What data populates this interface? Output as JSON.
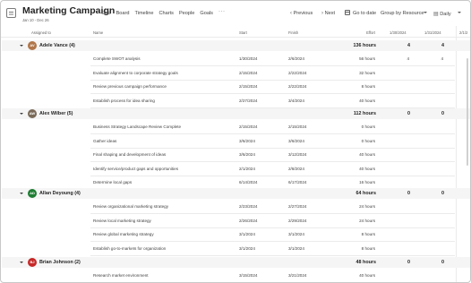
{
  "header": {
    "title": "Marketing Campaign",
    "subtitle": "Jan 10 - Dec 26",
    "views": [
      "Grid",
      "Board",
      "Timeline",
      "Charts",
      "People",
      "Goals"
    ],
    "more": "···",
    "previous": "Previous",
    "next": "Next",
    "go_to_date": "Go to date",
    "group_by": "Group by Resource",
    "timescale": "Daily"
  },
  "columns": {
    "assigned_to": "Assigned to",
    "name": "Name",
    "start": "Start",
    "finish": "Finish",
    "effort": "Effort",
    "date1": "1/30/2024",
    "date2": "1/31/2024",
    "date3": "2/1/2"
  },
  "groups": [
    {
      "name": "Adele Vance",
      "count": "(4)",
      "initials": "AV",
      "avatar_color": "#b0764a",
      "effort": "136 hours",
      "d1": "4",
      "d2": "4",
      "tasks": [
        {
          "name": "Complete SWOT analysis",
          "start": "1/30/2024",
          "finish": "2/6/2024",
          "effort": "56 hours",
          "d1": "4",
          "d2": "4"
        },
        {
          "name": "Evaluate alignment to corporate strategy goals",
          "start": "2/15/2024",
          "finish": "2/22/2024",
          "effort": "32 hours",
          "d1": "",
          "d2": ""
        },
        {
          "name": "Review previous campaign performance",
          "start": "2/15/2024",
          "finish": "2/22/2024",
          "effort": "8 hours",
          "d1": "",
          "d2": ""
        },
        {
          "name": "Establish process for idea sharing",
          "start": "2/27/2024",
          "finish": "3/4/2024",
          "effort": "40 hours",
          "d1": "",
          "d2": ""
        }
      ]
    },
    {
      "name": "Alex Wilber",
      "count": "(5)",
      "initials": "AW",
      "avatar_color": "#7a6a58",
      "effort": "112 hours",
      "d1": "0",
      "d2": "0",
      "tasks": [
        {
          "name": "Business Strategy Landscape Review Complete",
          "start": "2/15/2024",
          "finish": "2/15/2024",
          "effort": "0 hours",
          "d1": "",
          "d2": ""
        },
        {
          "name": "Gather ideas",
          "start": "3/6/2024",
          "finish": "3/6/2024",
          "effort": "0 hours",
          "d1": "",
          "d2": ""
        },
        {
          "name": "Final shaping and development of ideas",
          "start": "3/6/2024",
          "finish": "3/12/2024",
          "effort": "40 hours",
          "d1": "",
          "d2": ""
        },
        {
          "name": "Identify service/product gaps and opportunities",
          "start": "2/1/2024",
          "finish": "2/8/2024",
          "effort": "40 hours",
          "d1": "",
          "d2": ""
        },
        {
          "name": "Determine local gaps",
          "start": "6/14/2024",
          "finish": "6/17/2024",
          "effort": "16 hours",
          "d1": "",
          "d2": ""
        }
      ]
    },
    {
      "name": "Allan Deyoung",
      "count": "(4)",
      "initials": "AD",
      "avatar_color": "#1e7d32",
      "effort": "64 hours",
      "d1": "0",
      "d2": "0",
      "tasks": [
        {
          "name": "Review organizational marketing strategy",
          "start": "2/23/2024",
          "finish": "2/27/2024",
          "effort": "24 hours",
          "d1": "",
          "d2": ""
        },
        {
          "name": "Review local marketing strategy",
          "start": "2/26/2024",
          "finish": "2/29/2024",
          "effort": "24 hours",
          "d1": "",
          "d2": ""
        },
        {
          "name": "Review global marketing strategy",
          "start": "3/1/2024",
          "finish": "3/1/2024",
          "effort": "8 hours",
          "d1": "",
          "d2": ""
        },
        {
          "name": "Establish go-to-markets for organization",
          "start": "3/1/2024",
          "finish": "3/1/2024",
          "effort": "8 hours",
          "d1": "",
          "d2": ""
        }
      ]
    },
    {
      "name": "Brian Johnson",
      "count": "(2)",
      "initials": "BJ",
      "avatar_color": "#c62828",
      "effort": "48 hours",
      "d1": "0",
      "d2": "0",
      "tasks": [
        {
          "name": "Research market environment",
          "start": "3/15/2024",
          "finish": "3/21/2024",
          "effort": "40 hours",
          "d1": "",
          "d2": ""
        }
      ]
    }
  ]
}
